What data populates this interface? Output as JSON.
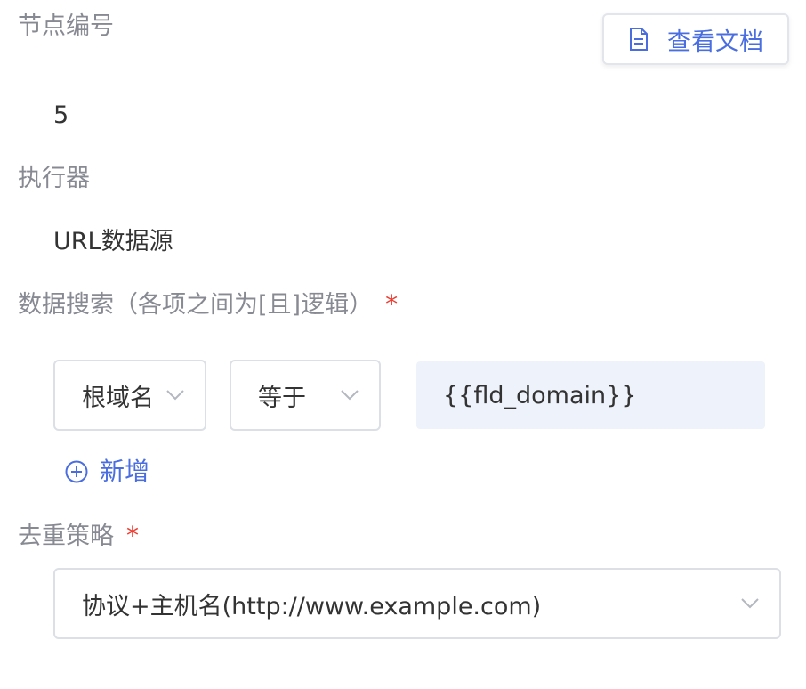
{
  "node": {
    "label": "节点编号",
    "value": "5"
  },
  "doc_button": {
    "label": "查看文档",
    "icon": "document-icon",
    "color": "#4a6ee0"
  },
  "executor": {
    "label": "执行器",
    "value": "URL数据源"
  },
  "search": {
    "label": "数据搜索（各项之间为[且]逻辑）",
    "required_mark": "*",
    "field_select": "根域名",
    "operator_select": "等于",
    "value_input": "{{fld_domain}}",
    "add_label": "新增"
  },
  "dedup": {
    "label": "去重策略",
    "required_mark": "*",
    "select_value": "协议+主机名(http://www.example.com)"
  },
  "colors": {
    "accent": "#4a6ee0",
    "required": "#ee3b2f",
    "label": "#888a93",
    "input_bg": "#eef3fb"
  }
}
